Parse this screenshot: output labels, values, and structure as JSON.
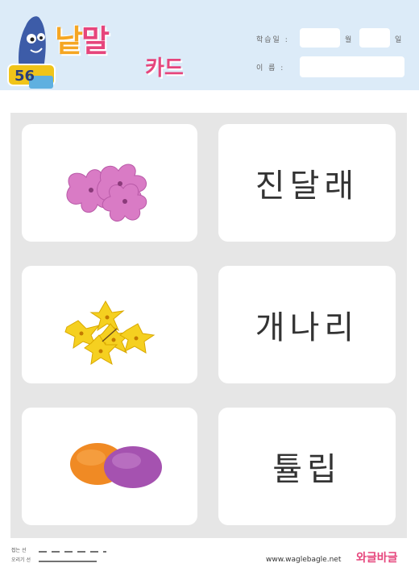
{
  "header": {
    "title_part1": "낱",
    "title_part2": "말",
    "title_sub": "카드",
    "mascot_sign": "56",
    "date_label": "학습일 :",
    "month_label": "월",
    "day_label": "일",
    "name_label": "이   름 :"
  },
  "cards": [
    {
      "image": "azalea-flower-icon",
      "word": "진달래"
    },
    {
      "image": "forsythia-flower-icon",
      "word": "개나리"
    },
    {
      "image": "tulip-bulbs-icon",
      "word": "튤립"
    }
  ],
  "footer": {
    "fold_label": "접는 선",
    "cut_label": "오리기 선",
    "url": "www.waglebagle.net",
    "brand_part1": "와글",
    "brand_part2": "바글"
  },
  "colors": {
    "header_bg": "#dcebf8",
    "title_orange": "#f5a623",
    "title_pink": "#e6457c",
    "board_bg": "#e6e6e6",
    "card_bg": "#ffffff"
  }
}
